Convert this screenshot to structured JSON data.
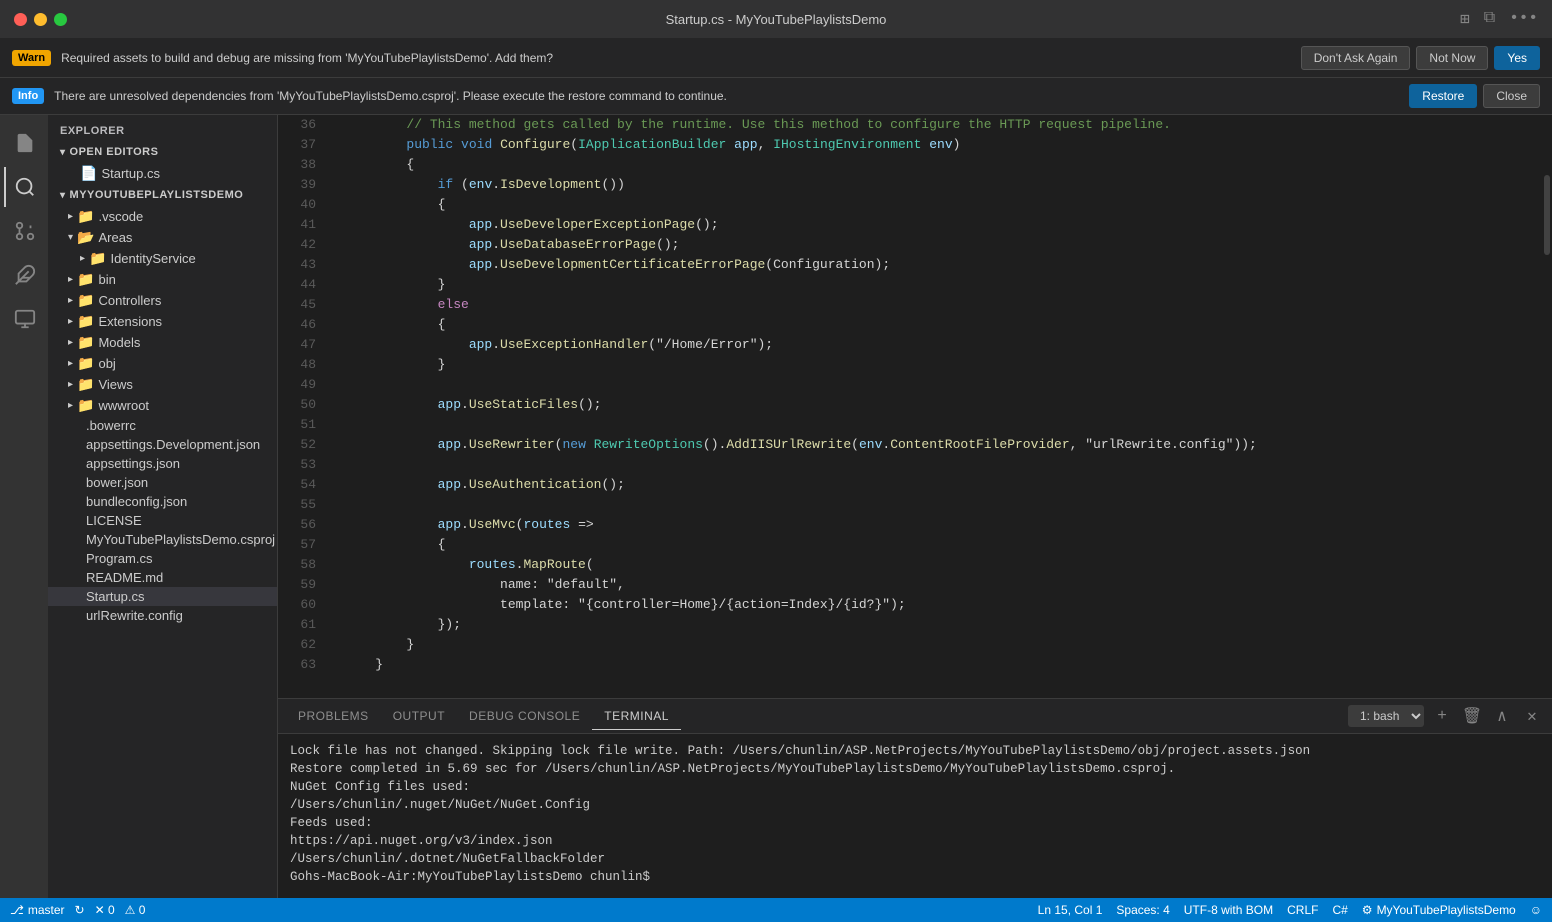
{
  "titleBar": {
    "title": "Startup.cs - MyYouTubePlaylistsDemo"
  },
  "notifications": {
    "warn": {
      "badge": "Warn",
      "message": "Required assets to build and debug are missing from 'MyYouTubePlaylistsDemo'. Add them?",
      "buttons": [
        "Don't Ask Again",
        "Not Now",
        "Yes"
      ]
    },
    "info": {
      "badge": "Info",
      "message": "There are unresolved dependencies from 'MyYouTubePlaylistsDemo.csproj'. Please execute the restore command to continue.",
      "buttons": [
        "Restore",
        "Close"
      ]
    }
  },
  "sidebar": {
    "header": "Explorer",
    "openEditors": {
      "label": "Open Editors",
      "items": [
        "Startup.cs"
      ]
    },
    "project": {
      "name": "MYYOUTUBEPLAYLISTSDEMO",
      "items": [
        {
          "label": ".vscode",
          "type": "folder",
          "indent": 1,
          "open": false
        },
        {
          "label": "Areas",
          "type": "folder",
          "indent": 1,
          "open": true
        },
        {
          "label": "IdentityService",
          "type": "folder",
          "indent": 2,
          "open": false
        },
        {
          "label": "bin",
          "type": "folder",
          "indent": 1,
          "open": false
        },
        {
          "label": "Controllers",
          "type": "folder",
          "indent": 1,
          "open": false
        },
        {
          "label": "Extensions",
          "type": "folder",
          "indent": 1,
          "open": false
        },
        {
          "label": "Models",
          "type": "folder",
          "indent": 1,
          "open": false
        },
        {
          "label": "obj",
          "type": "folder",
          "indent": 1,
          "open": false
        },
        {
          "label": "Views",
          "type": "folder",
          "indent": 1,
          "open": false
        },
        {
          "label": "wwwroot",
          "type": "folder",
          "indent": 1,
          "open": false
        },
        {
          "label": ".bowerrc",
          "type": "file",
          "indent": 1
        },
        {
          "label": "appsettings.Development.json",
          "type": "file",
          "indent": 1
        },
        {
          "label": "appsettings.json",
          "type": "file",
          "indent": 1
        },
        {
          "label": "bower.json",
          "type": "file",
          "indent": 1
        },
        {
          "label": "bundleconfig.json",
          "type": "file",
          "indent": 1
        },
        {
          "label": "LICENSE",
          "type": "file",
          "indent": 1
        },
        {
          "label": "MyYouTubePlaylistsDemo.csproj",
          "type": "file",
          "indent": 1
        },
        {
          "label": "Program.cs",
          "type": "file",
          "indent": 1
        },
        {
          "label": "README.md",
          "type": "file",
          "indent": 1
        },
        {
          "label": "Startup.cs",
          "type": "file",
          "indent": 1,
          "active": true
        },
        {
          "label": "urlRewrite.config",
          "type": "file",
          "indent": 1
        }
      ]
    }
  },
  "codeLines": [
    {
      "num": 36,
      "content": "        // This method gets called by the runtime. Use this method to configure the HTTP request pipeline."
    },
    {
      "num": 37,
      "content": "        public void Configure(IApplicationBuilder app, IHostingEnvironment env)"
    },
    {
      "num": 38,
      "content": "        {"
    },
    {
      "num": 39,
      "content": "            if (env.IsDevelopment())"
    },
    {
      "num": 40,
      "content": "            {"
    },
    {
      "num": 41,
      "content": "                app.UseDeveloperExceptionPage();"
    },
    {
      "num": 42,
      "content": "                app.UseDatabaseErrorPage();"
    },
    {
      "num": 43,
      "content": "                app.UseDevelopmentCertificateErrorPage(Configuration);"
    },
    {
      "num": 44,
      "content": "            }"
    },
    {
      "num": 45,
      "content": "            else"
    },
    {
      "num": 46,
      "content": "            {"
    },
    {
      "num": 47,
      "content": "                app.UseExceptionHandler(\"/Home/Error\");"
    },
    {
      "num": 48,
      "content": "            }"
    },
    {
      "num": 49,
      "content": ""
    },
    {
      "num": 50,
      "content": "            app.UseStaticFiles();"
    },
    {
      "num": 51,
      "content": ""
    },
    {
      "num": 52,
      "content": "            app.UseRewriter(new RewriteOptions().AddIISUrlRewrite(env.ContentRootFileProvider, \"urlRewrite.config\"));"
    },
    {
      "num": 53,
      "content": ""
    },
    {
      "num": 54,
      "content": "            app.UseAuthentication();"
    },
    {
      "num": 55,
      "content": ""
    },
    {
      "num": 56,
      "content": "            app.UseMvc(routes =>"
    },
    {
      "num": 57,
      "content": "            {"
    },
    {
      "num": 58,
      "content": "                routes.MapRoute("
    },
    {
      "num": 59,
      "content": "                    name: \"default\","
    },
    {
      "num": 60,
      "content": "                    template: \"{controller=Home}/{action=Index}/{id?}\");"
    },
    {
      "num": 61,
      "content": "            });"
    },
    {
      "num": 62,
      "content": "        }"
    },
    {
      "num": 63,
      "content": "    }"
    }
  ],
  "bottomPanel": {
    "tabs": [
      "PROBLEMS",
      "OUTPUT",
      "DEBUG CONSOLE",
      "TERMINAL"
    ],
    "activeTab": "TERMINAL",
    "terminalLabel": "1: bash",
    "terminalContent": [
      "Lock file has not changed. Skipping lock file write. Path: /Users/chunlin/ASP.NetProjects/MyYouTubePlaylistsDemo/obj/project.assets.json",
      "Restore completed in 5.69 sec for /Users/chunlin/ASP.NetProjects/MyYouTubePlaylistsDemo/MyYouTubePlaylistsDemo.csproj.",
      "",
      "NuGet Config files used:",
      "    /Users/chunlin/.nuget/NuGet/NuGet.Config",
      "",
      "Feeds used:",
      "    https://api.nuget.org/v3/index.json",
      "    /Users/chunlin/.dotnet/NuGetFallbackFolder",
      "Gohs-MacBook-Air:MyYouTubePlaylistsDemo chunlin$ "
    ]
  },
  "statusBar": {
    "branch": "master",
    "syncIcon": "↻",
    "errors": "✕ 0",
    "warnings": "⚠ 0",
    "position": "Ln 15, Col 1",
    "spaces": "Spaces: 4",
    "encoding": "UTF-8 with BOM",
    "lineEnding": "CRLF",
    "language": "C#",
    "projectName": "MyYouTubePlaylistsDemo",
    "smileyIcon": "☺"
  }
}
